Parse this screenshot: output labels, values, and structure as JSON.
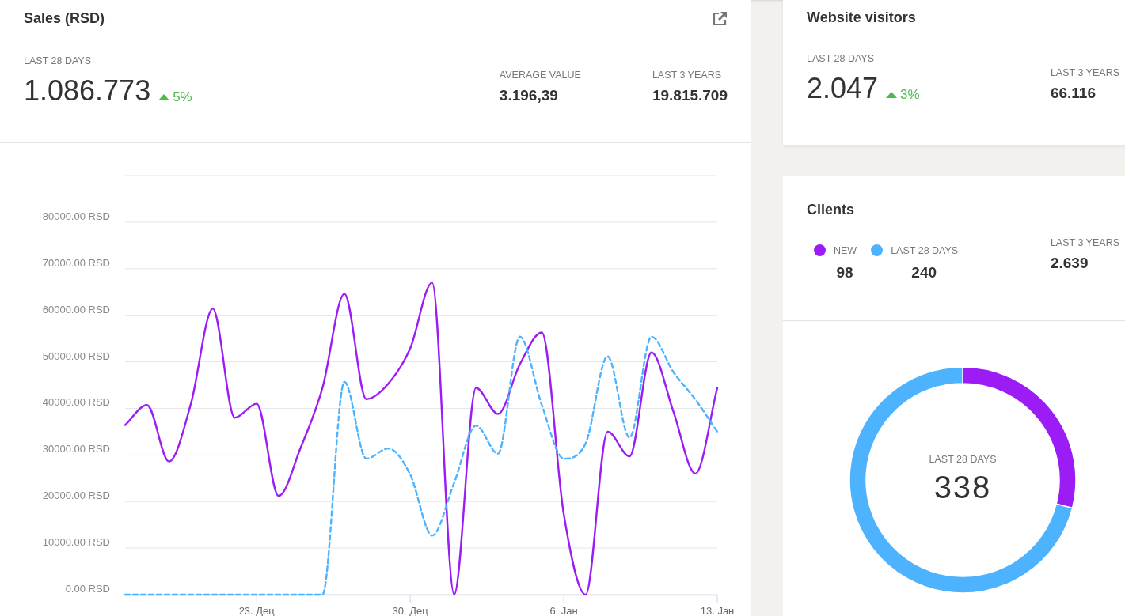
{
  "sales": {
    "title": "Sales (RSD)",
    "period_label": "LAST 28 DAYS",
    "total": "1.086.773",
    "change": {
      "increase": true,
      "text": "5%"
    },
    "stats": [
      {
        "label": "AVERAGE VALUE",
        "value": "3.196,39"
      },
      {
        "label": "LAST 3 YEARS",
        "value": "19.815.709"
      }
    ],
    "chart_data": {
      "type": "line",
      "grid": true,
      "categories": [
        null,
        null,
        null,
        null,
        null,
        null,
        "23. Дец",
        null,
        null,
        null,
        null,
        null,
        null,
        "30. Дец",
        null,
        null,
        null,
        null,
        null,
        null,
        "6. Јан",
        null,
        null,
        null,
        null,
        null,
        null,
        "13. Јан"
      ],
      "ylim": [
        0,
        90000
      ],
      "yticks": [
        {
          "value": 0,
          "label": "0.00 RSD"
        },
        {
          "value": 10000,
          "label": "10000.00 RSD"
        },
        {
          "value": 20000,
          "label": "20000.00 RSD"
        },
        {
          "value": 30000,
          "label": "30000.00 RSD"
        },
        {
          "value": 40000,
          "label": "40000.00 RSD"
        },
        {
          "value": 50000,
          "label": "50000.00 RSD"
        },
        {
          "value": 60000,
          "label": "60000.00 RSD"
        },
        {
          "value": 70000,
          "label": "70000.00 RSD"
        },
        {
          "value": 80000,
          "label": "80000.00 RSD"
        }
      ],
      "series": [
        {
          "line_style": "solid",
          "color": "#9b1cf5",
          "values": [
            36400,
            40700,
            28600,
            41000,
            61400,
            38000,
            41000,
            21200,
            31500,
            44400,
            64600,
            42000,
            45300,
            52900,
            67000,
            0,
            44400,
            38800,
            49500,
            56300,
            17300,
            0,
            35000,
            29700,
            52000,
            39300,
            26000,
            44400
          ]
        },
        {
          "line_style": "dashed",
          "color": "#4db3ff",
          "values": [
            0,
            0,
            0,
            0,
            0,
            0,
            0,
            0,
            0,
            0,
            45700,
            29200,
            31400,
            25800,
            12700,
            24000,
            36300,
            30300,
            55400,
            40700,
            29200,
            32500,
            51200,
            33700,
            55400,
            47800,
            41900,
            35000
          ]
        }
      ]
    }
  },
  "visitors": {
    "title": "Website visitors",
    "period_label": "LAST 28 DAYS",
    "total": "2.047",
    "change": {
      "increase": true,
      "text": "3%"
    },
    "stats": [
      {
        "label": "LAST 3 YEARS",
        "value": "66.116"
      }
    ]
  },
  "clients": {
    "title": "Clients",
    "legend": [
      {
        "label": "NEW",
        "value": "98",
        "color": "#9b1cf5"
      },
      {
        "label": "LAST 28 DAYS",
        "value": "240",
        "color": "#4db3ff"
      }
    ],
    "stats": [
      {
        "label": "LAST 3 YEARS",
        "value": "2.639"
      }
    ],
    "donut": {
      "center_label": "LAST 28 DAYS",
      "center_value": "338",
      "chart_data": {
        "type": "donut",
        "values": [
          29,
          71
        ]
      }
    }
  }
}
